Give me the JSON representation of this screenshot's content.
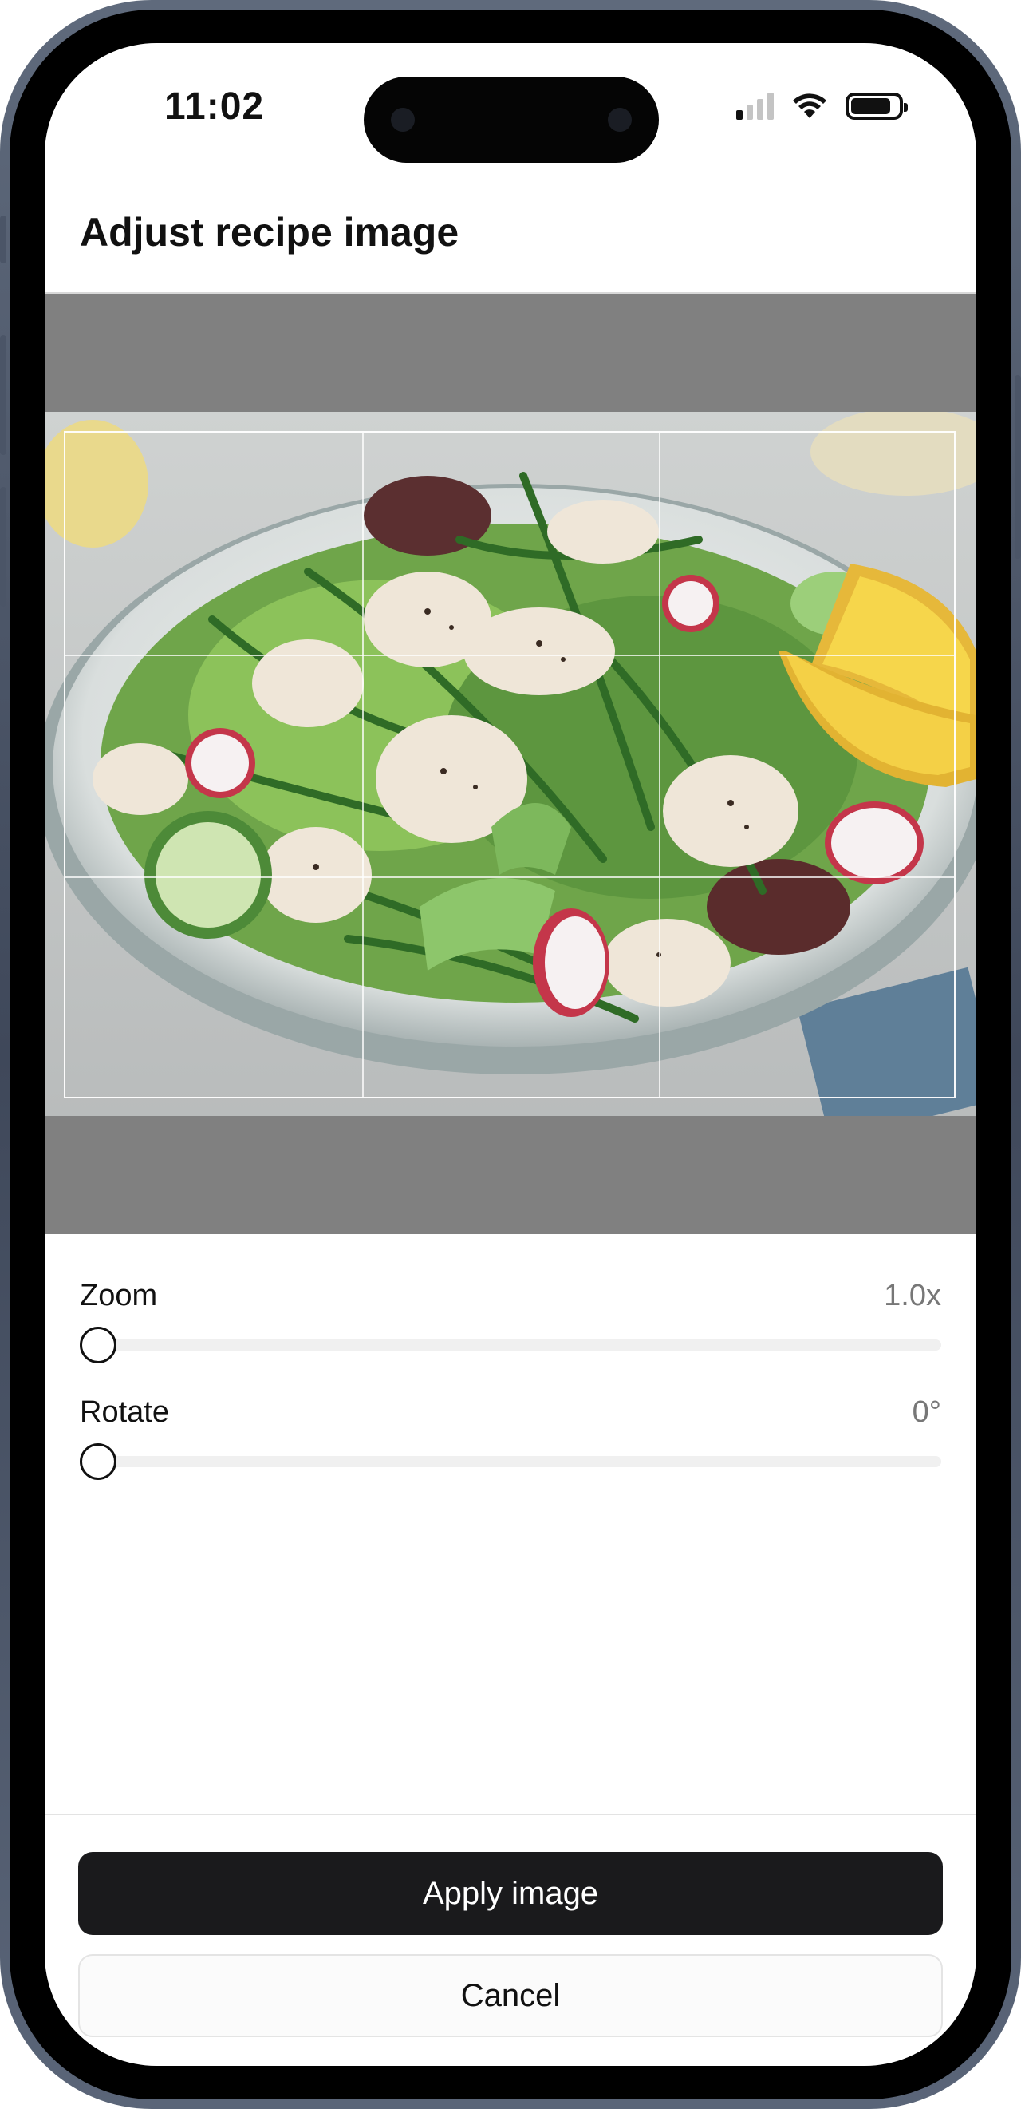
{
  "status_bar": {
    "time": "11:02",
    "signal_bars_active": 1,
    "icons": [
      "cellular-signal-icon",
      "wifi-icon",
      "battery-icon"
    ]
  },
  "header": {
    "title": "Adjust recipe image"
  },
  "editor": {
    "image": "salad-photo",
    "crop_grid": "rule-of-thirds"
  },
  "controls": {
    "zoom": {
      "label": "Zoom",
      "value": "1.0x",
      "level": 0
    },
    "rotate": {
      "label": "Rotate",
      "value": "0°",
      "level": 0
    }
  },
  "actions": {
    "apply_label": "Apply image",
    "cancel_label": "Cancel"
  },
  "colors": {
    "primary_button": "#1a1a1c",
    "stage_background": "#808080",
    "device_frame": "#4b5567"
  }
}
